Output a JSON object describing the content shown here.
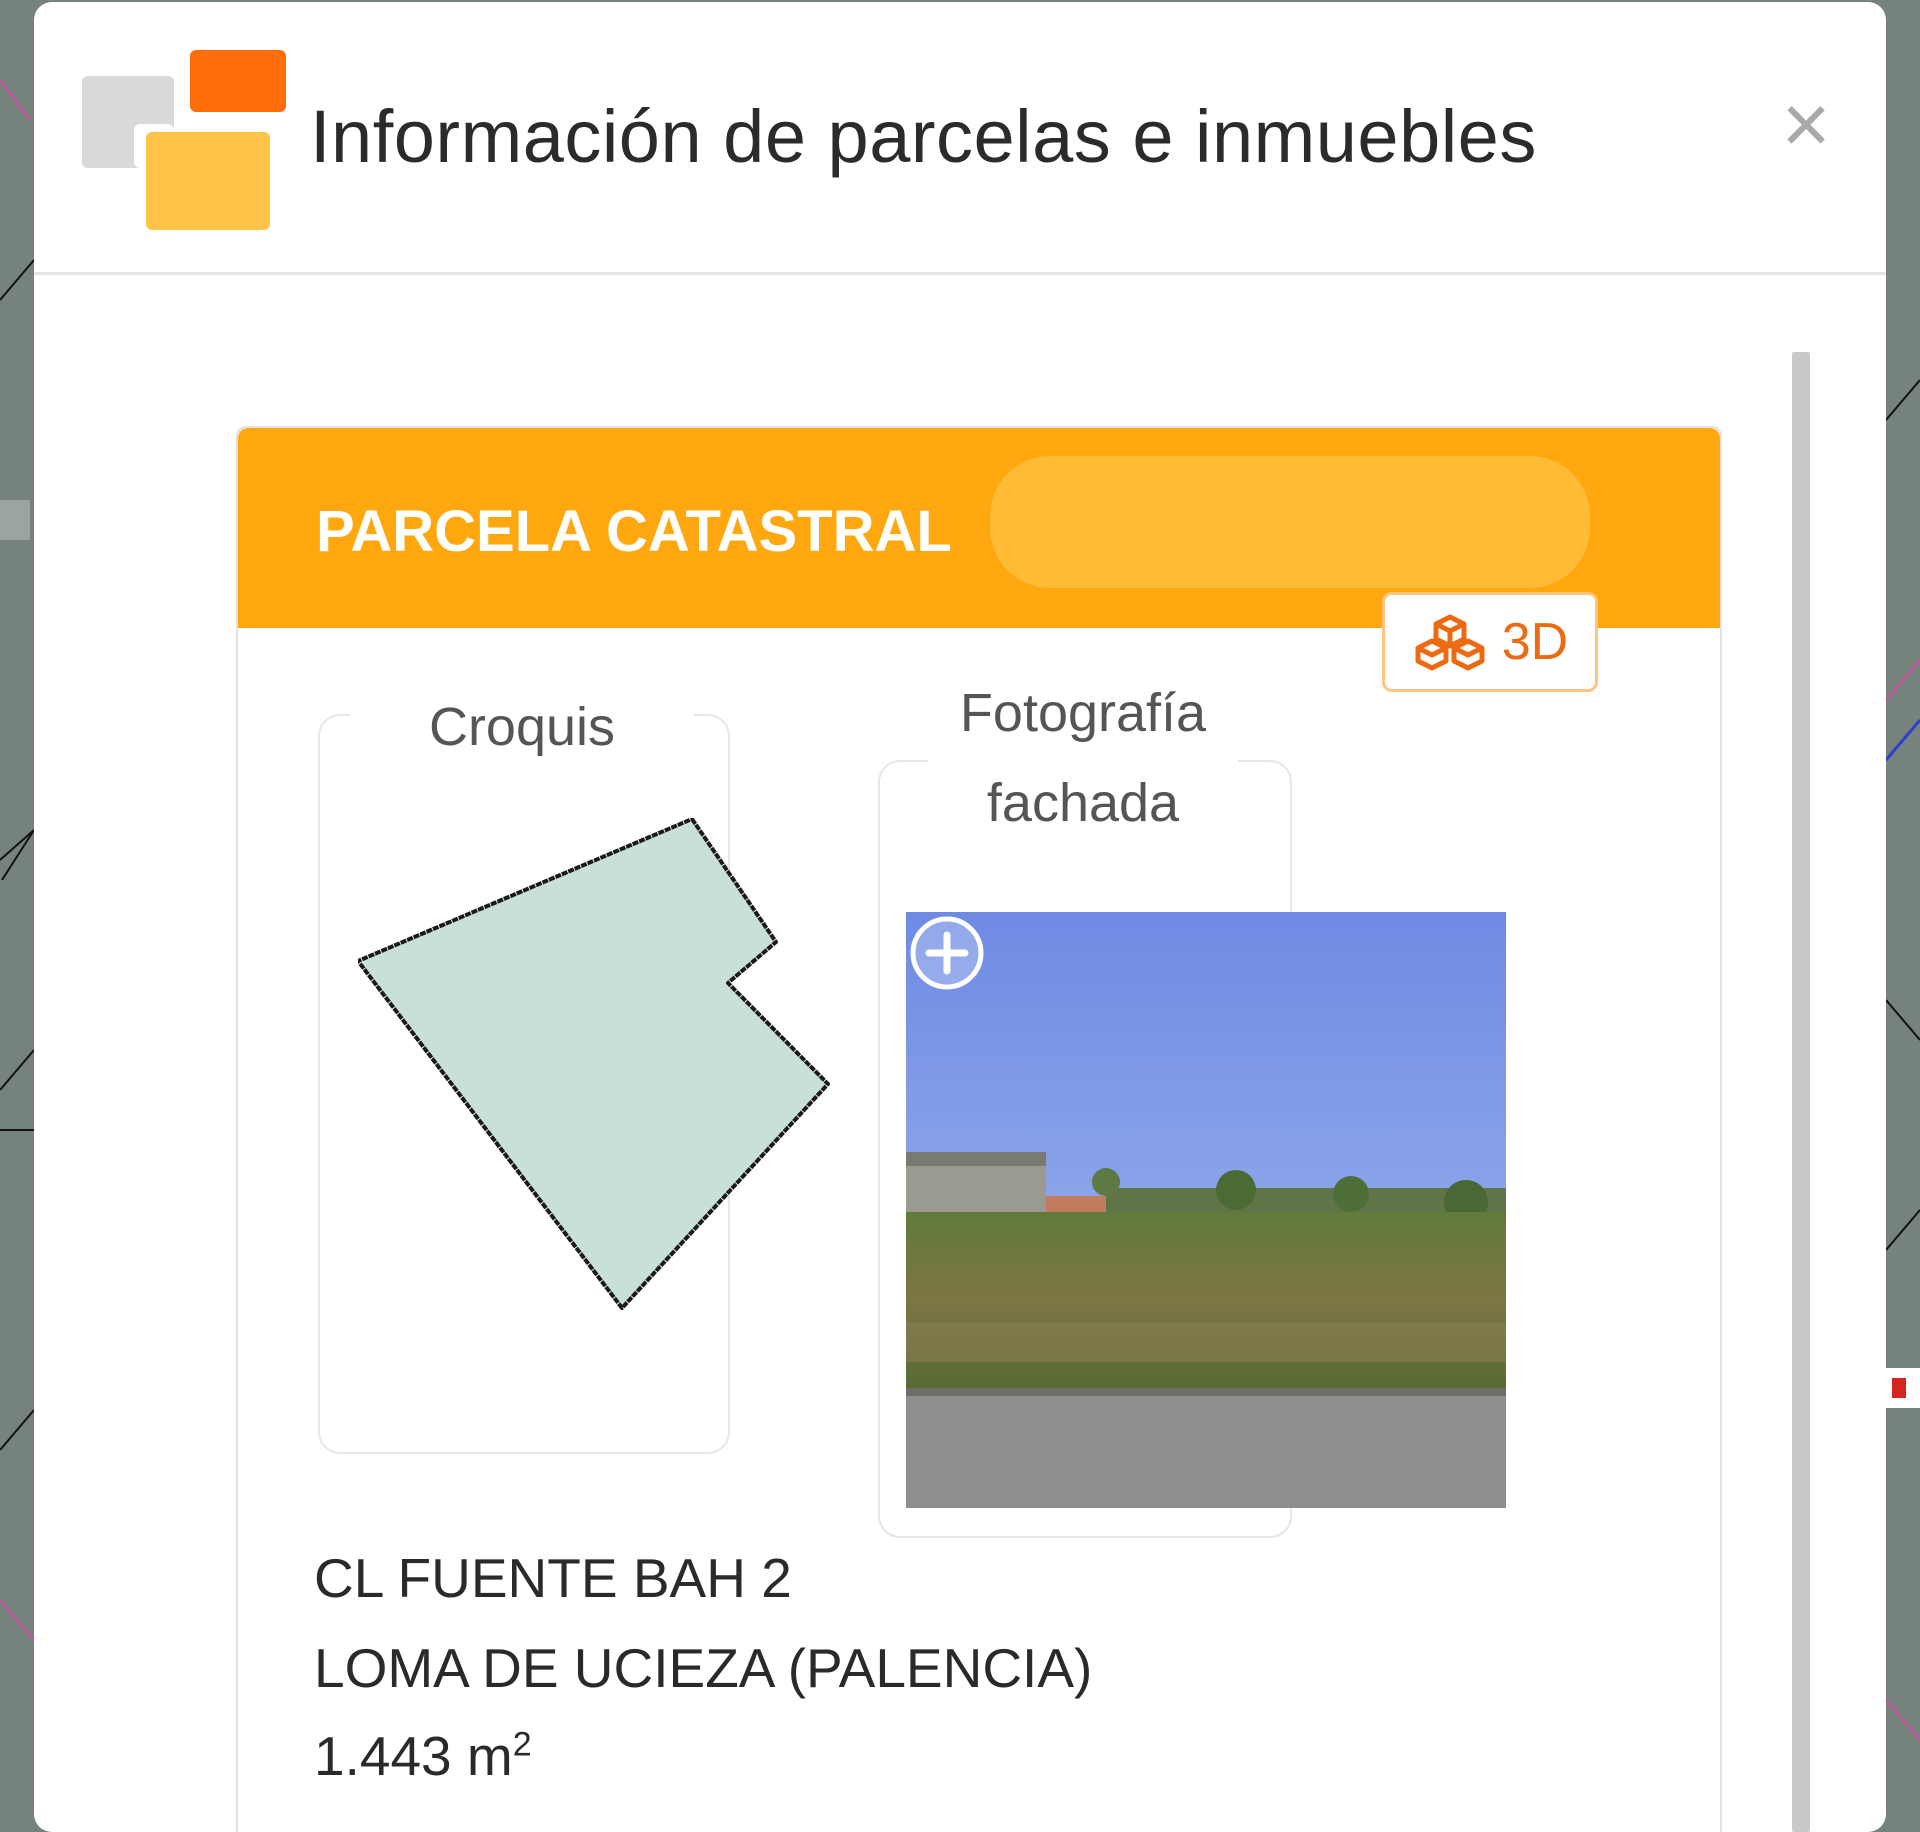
{
  "modal": {
    "title": "Información de parcelas e inmuebles",
    "close_label": "×"
  },
  "card": {
    "title": "PARCELA CATASTRAL",
    "btn_3d_label": "3D",
    "sketch_label": "Croquis",
    "photo_label_line1": "Fotografía",
    "photo_label_line2": "fachada",
    "address_line1": "CL FUENTE BAH 2",
    "address_line2": "LOMA DE UCIEZA (PALENCIA)",
    "area_value": "1.443 m",
    "area_unit_exp": "2"
  },
  "icons": {
    "logo": "catastro-logo",
    "close": "close-icon",
    "three_d": "cubes-3d-icon",
    "zoom": "zoom-plus-icon"
  },
  "colors": {
    "accent": "#ffa70e",
    "button_text": "#ec6a11",
    "sketch_fill": "#c9e0d6",
    "map_background": "#76837d"
  }
}
